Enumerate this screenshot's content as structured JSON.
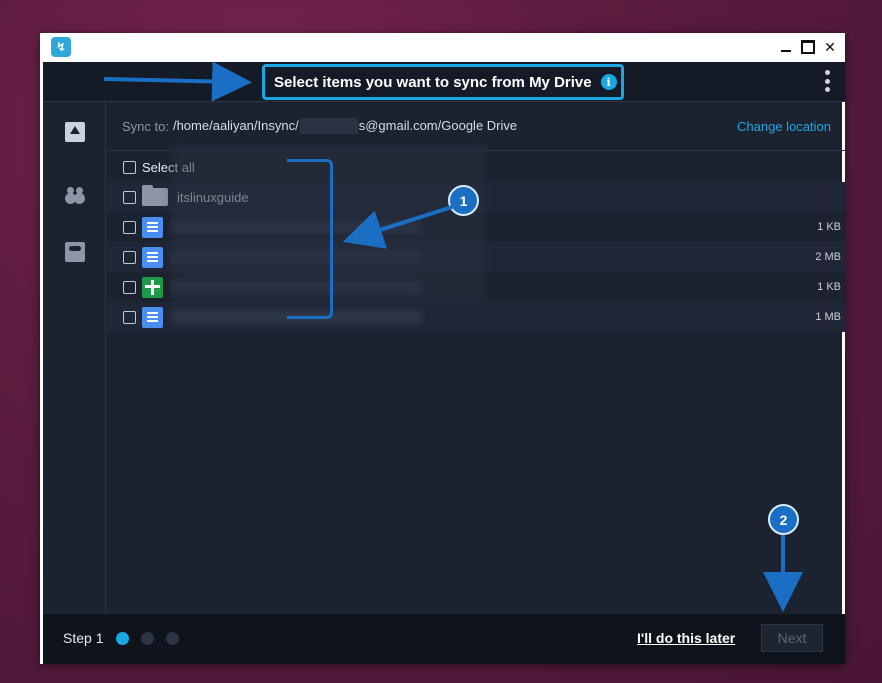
{
  "titlebar": {
    "app_icon": "insync-logo-icon",
    "controls": [
      "minimize-icon",
      "maximize-icon",
      "close-icon"
    ],
    "close_glyph": "✕"
  },
  "header": {
    "title": "Select items you want to sync from My Drive",
    "info_glyph": "i",
    "menu_icon": "kebab-menu-icon"
  },
  "sidebar": {
    "items": [
      {
        "icon": "my-drive-icon"
      },
      {
        "icon": "shared-with-me-icon"
      },
      {
        "icon": "shared-drives-icon"
      }
    ]
  },
  "sync": {
    "label": "Sync to:",
    "path_prefix": "/home/aaliyan/Insync/",
    "path_suffix": "s@gmail.com/Google Drive",
    "change_location": "Change location"
  },
  "list": {
    "select_all": "Select all",
    "items": [
      {
        "type": "folder",
        "name": "itslinuxguide",
        "size": ""
      },
      {
        "type": "doc",
        "name": "",
        "size": "1 KB"
      },
      {
        "type": "doc",
        "name": "",
        "size": "2 MB"
      },
      {
        "type": "sheet",
        "name": "",
        "size": "1 KB"
      },
      {
        "type": "doc",
        "name": "",
        "size": "1 MB"
      }
    ]
  },
  "annotations": {
    "callout_1": "1",
    "callout_2": "2",
    "color": "#1a6fc4"
  },
  "footer": {
    "step_label": "Step 1",
    "steps_total": 3,
    "current_step": 1,
    "later_link": "I'll do this later",
    "next_button": "Next"
  },
  "colors": {
    "accent": "#1aa7e6",
    "background": "#1b2230",
    "annotation": "#1a6fc4"
  }
}
